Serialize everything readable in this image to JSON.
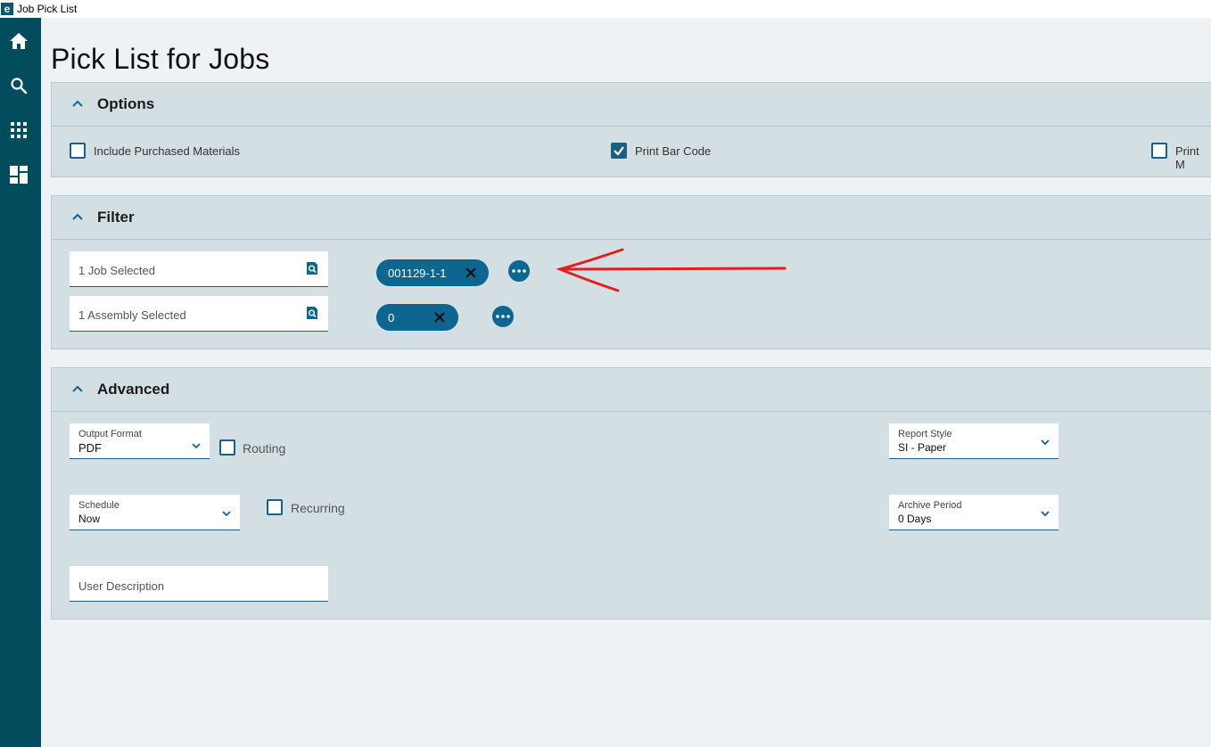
{
  "window": {
    "title": "Job Pick List",
    "logo_letter": "e"
  },
  "sidebar": {
    "items": [
      {
        "name": "home-icon"
      },
      {
        "name": "search-icon"
      },
      {
        "name": "grid-icon"
      },
      {
        "name": "dashboard-icon"
      }
    ]
  },
  "page": {
    "title": "Pick List for Jobs"
  },
  "options": {
    "title": "Options",
    "include_purchased": {
      "label": "Include Purchased Materials",
      "checked": false
    },
    "print_bar_code": {
      "label": "Print Bar Code",
      "checked": true
    },
    "print_m": {
      "label": "Print M",
      "checked": false
    }
  },
  "filter": {
    "title": "Filter",
    "job_field": {
      "value": "1 Job Selected"
    },
    "assembly_field": {
      "value": "1 Assembly Selected"
    },
    "job_chip": {
      "label": "001129-1-1"
    },
    "assembly_chip": {
      "label": "0"
    }
  },
  "advanced": {
    "title": "Advanced",
    "output_format": {
      "label": "Output Format",
      "value": "PDF"
    },
    "routing": {
      "label": "Routing",
      "checked": false
    },
    "report_style": {
      "label": "Report Style",
      "value": "SI - Paper"
    },
    "schedule": {
      "label": "Schedule",
      "value": "Now"
    },
    "recurring": {
      "label": "Recurring",
      "checked": false
    },
    "archive_period": {
      "label": "Archive Period",
      "value": "0 Days"
    },
    "user_description": {
      "placeholder": "User Description"
    }
  },
  "colors": {
    "sidebar": "#014d5e",
    "accent": "#0c6690",
    "section_bg": "#d3dfe3",
    "annotation": "#e02020"
  }
}
